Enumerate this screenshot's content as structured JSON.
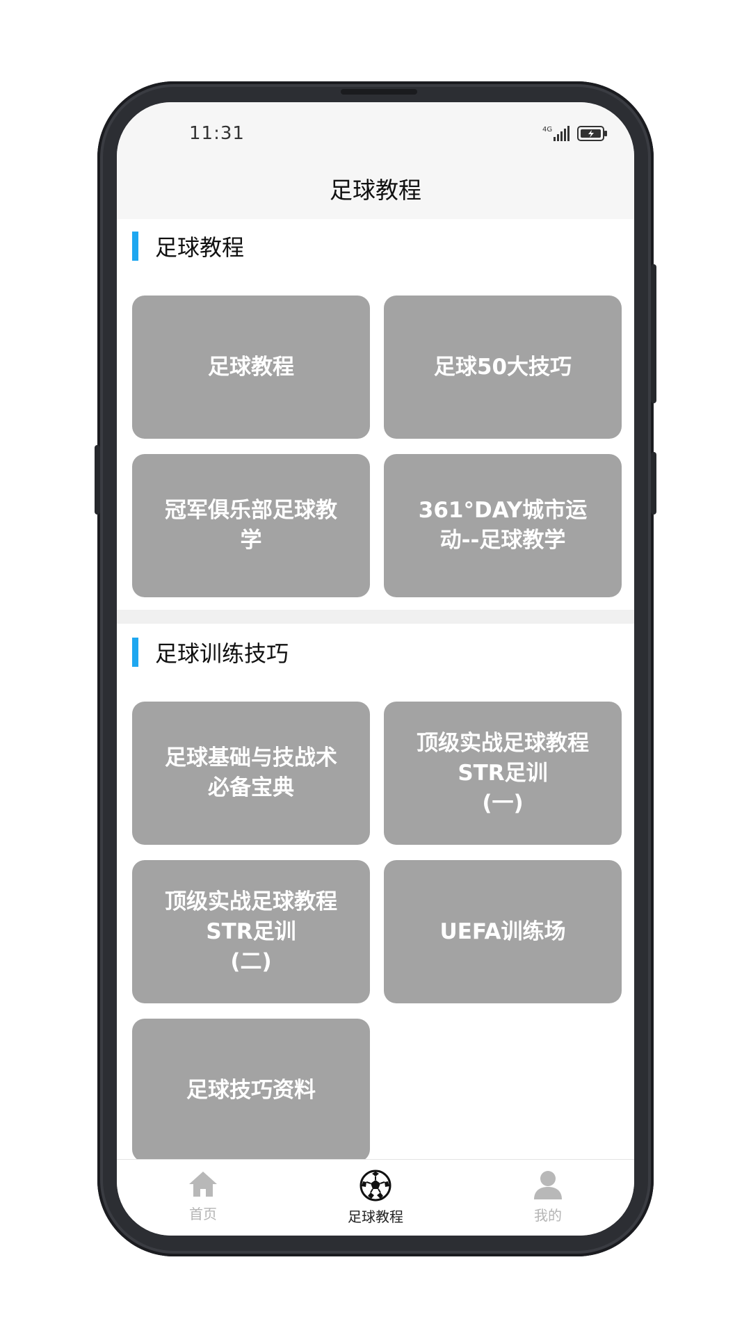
{
  "status_bar": {
    "time": "11:31",
    "network": "4G"
  },
  "header": {
    "title": "足球教程"
  },
  "sections": [
    {
      "title": "足球教程",
      "cards": [
        {
          "label": "足球教程"
        },
        {
          "label": "足球50大技巧"
        },
        {
          "label": "冠军俱乐部足球教学"
        },
        {
          "label": "361°DAY城市运动--足球教学"
        }
      ]
    },
    {
      "title": "足球训练技巧",
      "cards": [
        {
          "label": "足球基础与技战术必备宝典"
        },
        {
          "label": "顶级实战足球教程STR足训\n(一)"
        },
        {
          "label": "顶级实战足球教程STR足训\n(二)"
        },
        {
          "label": "UEFA训练场"
        },
        {
          "label": "足球技巧资料"
        }
      ]
    }
  ],
  "bottom_nav": {
    "items": [
      {
        "label": "首页",
        "icon": "home-icon",
        "active": false
      },
      {
        "label": "足球教程",
        "icon": "soccer-ball-icon",
        "active": true
      },
      {
        "label": "我的",
        "icon": "user-icon",
        "active": false
      }
    ]
  },
  "colors": {
    "accent": "#1ea7f0",
    "card_bg": "#a3a3a3",
    "frame": "#2c2e33"
  }
}
